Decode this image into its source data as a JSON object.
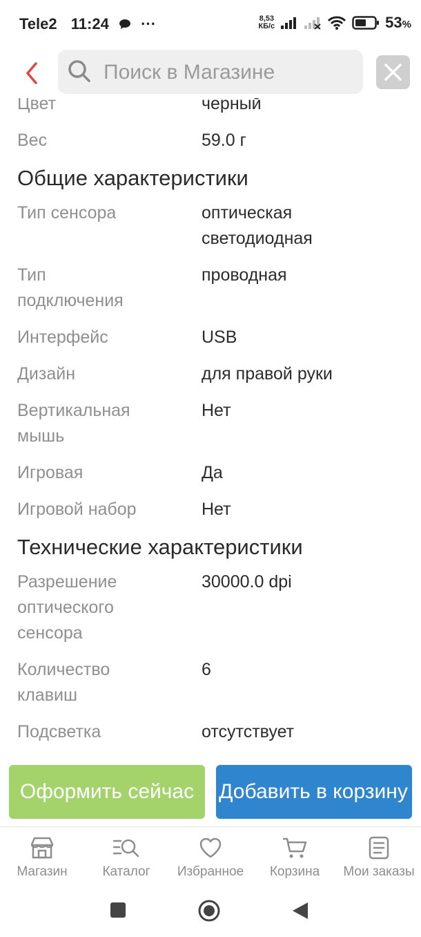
{
  "status_bar": {
    "carrier": "Tele2",
    "time": "11:24",
    "dots": "···",
    "speed_value": "8,53",
    "speed_unit": "КБ/с",
    "battery_pct": "53",
    "battery_sign": "%"
  },
  "search": {
    "placeholder": "Поиск в Магазине"
  },
  "specs": {
    "top_rows": [
      {
        "key": "Цвет",
        "value": "черный"
      },
      {
        "key": "Вес",
        "value": "59.0 г"
      }
    ],
    "section_general": "Общие характеристики",
    "general_rows": [
      {
        "key": "Тип сенсора",
        "value": "оптическая светодиодная"
      },
      {
        "key": "Тип подключения",
        "value": "проводная"
      },
      {
        "key": "Интерфейс",
        "value": "USB"
      },
      {
        "key": "Дизайн",
        "value": "для правой руки"
      },
      {
        "key": "Вертикальная мышь",
        "value": "Нет"
      },
      {
        "key": "Игровая",
        "value": "Да"
      },
      {
        "key": "Игровой набор",
        "value": "Нет"
      }
    ],
    "section_tech": "Технические характеристики",
    "tech_rows": [
      {
        "key": "Разрешение оптического сенсора",
        "value": "30000.0 dpi"
      },
      {
        "key": "Количество клавиш",
        "value": "6"
      },
      {
        "key": "Подсветка",
        "value": "отсутствует"
      }
    ]
  },
  "actions": {
    "buy_now": "Оформить сейчас",
    "add_to_cart": "Добавить в корзину"
  },
  "tabs": [
    {
      "label": "Магазин",
      "icon": "store-icon"
    },
    {
      "label": "Каталог",
      "icon": "catalog-search-icon"
    },
    {
      "label": "Избранное",
      "icon": "heart-icon"
    },
    {
      "label": "Корзина",
      "icon": "cart-icon"
    },
    {
      "label": "Мои заказы",
      "icon": "orders-icon"
    }
  ],
  "colors": {
    "accent_red": "#e0473c",
    "buy_green": "#a3d36a",
    "cart_blue": "#2f86cf"
  }
}
